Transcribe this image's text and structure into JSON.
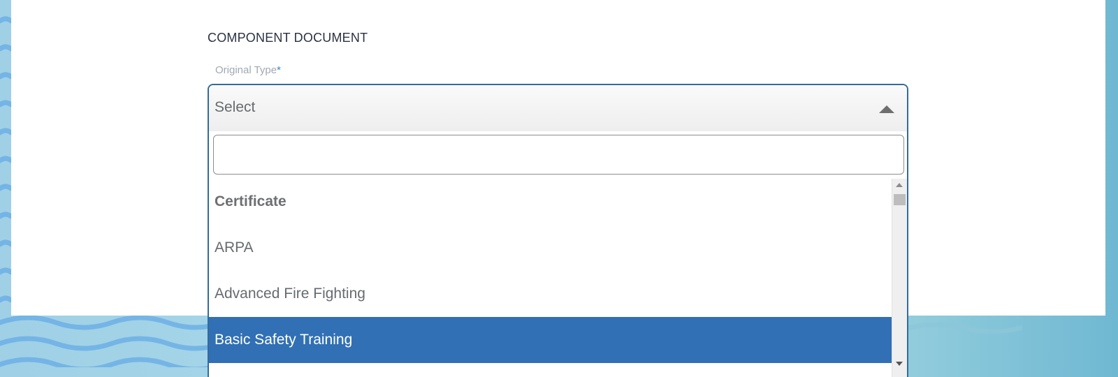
{
  "section": {
    "title": "COMPONENT DOCUMENT"
  },
  "field": {
    "label": "Original Type",
    "required_marker": "*",
    "selected_value": "Select",
    "search_value": ""
  },
  "dropdown": {
    "group_label": "Certificate",
    "options": [
      "ARPA",
      "Advanced Fire Fighting",
      "Basic Safety Training"
    ],
    "highlighted_option": "Basic Safety Training"
  },
  "colors": {
    "highlight": "#3170b4",
    "border": "#336b99",
    "required": "#3c82c4"
  }
}
